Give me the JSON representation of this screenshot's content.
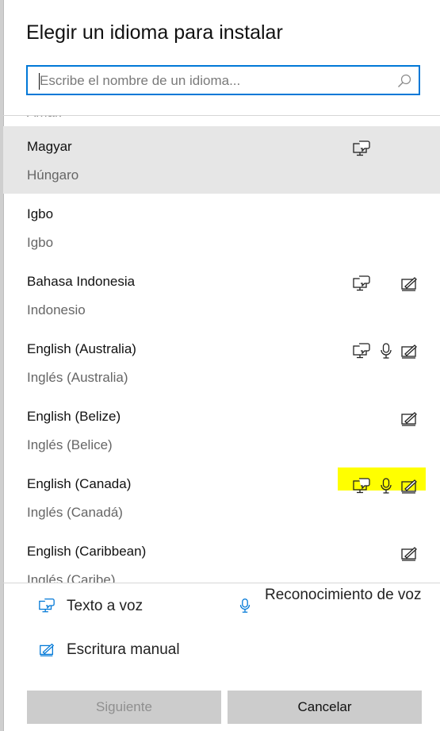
{
  "dialog": {
    "title": "Elegir un idioma para instalar"
  },
  "search": {
    "placeholder": "Escribe el nombre de un idioma..."
  },
  "languages": [
    {
      "name": "Amharic-partial",
      "native": "Amar.",
      "translated": "",
      "features": []
    },
    {
      "name": "Magyar",
      "native": "Magyar",
      "translated": "Húngaro",
      "features": [
        "tts"
      ],
      "selected": true
    },
    {
      "name": "Igbo",
      "native": "Igbo",
      "translated": "Igbo",
      "features": []
    },
    {
      "name": "Bahasa Indonesia",
      "native": "Bahasa Indonesia",
      "translated": "Indonesio",
      "features": [
        "tts",
        "handwriting"
      ]
    },
    {
      "name": "English (Australia)",
      "native": "English (Australia)",
      "translated": "Inglés (Australia)",
      "features": [
        "tts",
        "speech",
        "handwriting"
      ]
    },
    {
      "name": "English (Belize)",
      "native": "English (Belize)",
      "translated": "Inglés (Belice)",
      "features": [
        "handwriting"
      ]
    },
    {
      "name": "English (Canada)",
      "native": "English (Canada)",
      "translated": "Inglés (Canadá)",
      "features": [
        "tts",
        "speech",
        "handwriting"
      ],
      "highlighted": true
    },
    {
      "name": "English (Caribbean)",
      "native": "English (Caribbean)",
      "translated": "Inglés (Caribe)",
      "features": [
        "handwriting"
      ]
    }
  ],
  "legend": {
    "tts_label": "Texto a voz",
    "speech_label": "Reconocimiento de voz",
    "handwriting_label": "Escritura manual"
  },
  "buttons": {
    "next_label": "Siguiente",
    "cancel_label": "Cancelar"
  },
  "colors": {
    "accent": "#0078d7",
    "selected_row": "#e6e6e6",
    "highlight": "#ffff00",
    "icon_blue": "#0078d7"
  },
  "icons": {
    "tts": "text-to-speech-icon",
    "speech": "microphone-icon",
    "handwriting": "handwriting-icon",
    "search": "search-icon"
  }
}
